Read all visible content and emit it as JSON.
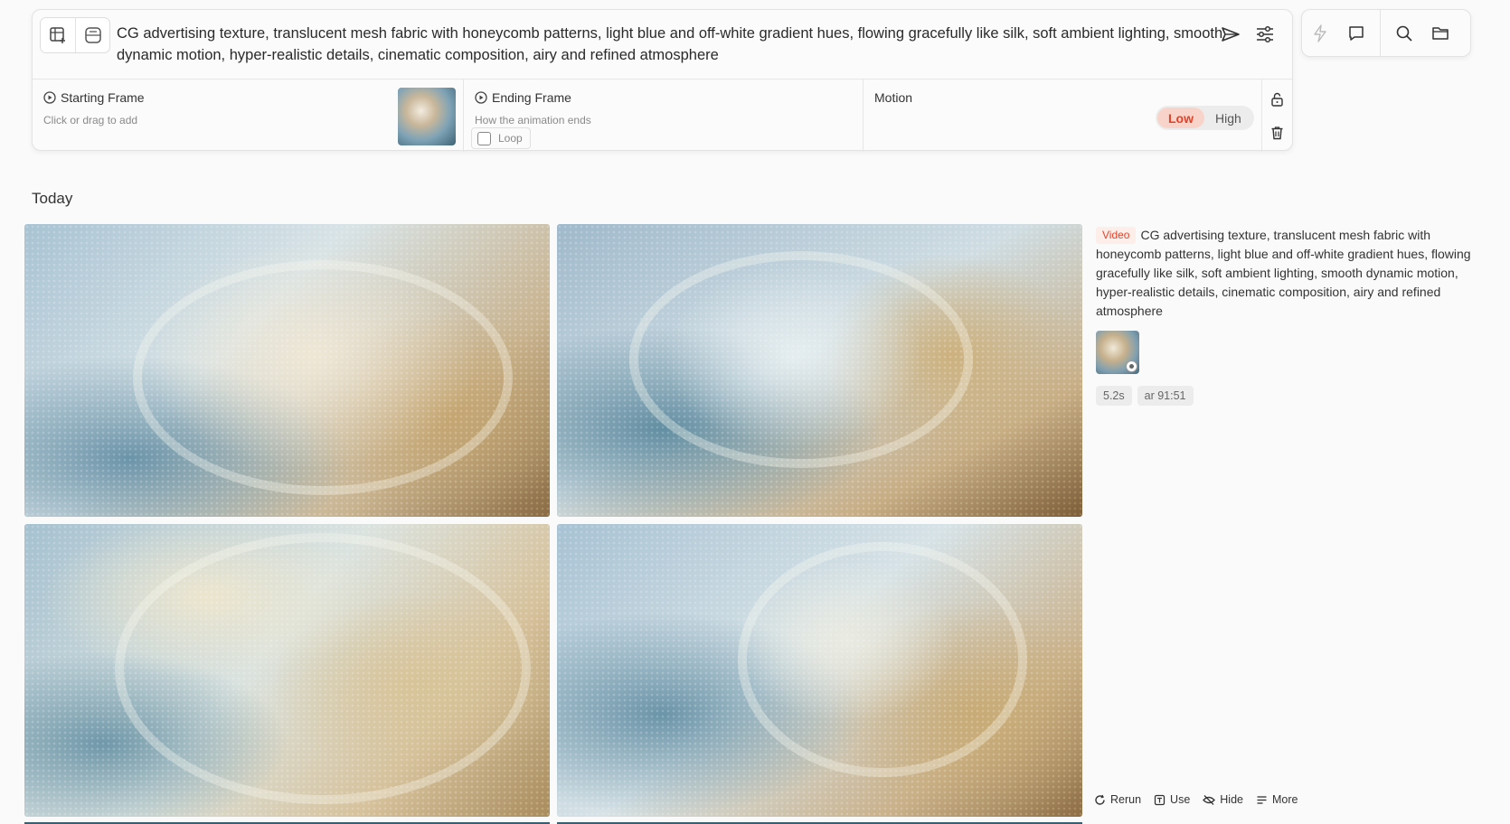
{
  "composer": {
    "prompt": "CG advertising texture, translucent mesh fabric with honeycomb patterns, light blue and off-white gradient hues, flowing gracefully like silk, soft ambient lighting, smooth dynamic motion, hyper-realistic details, cinematic composition, airy and refined atmosphere",
    "starting_frame": {
      "label": "Starting Frame",
      "hint": "Click or drag to add"
    },
    "ending_frame": {
      "label": "Ending Frame",
      "hint": "How the animation ends",
      "loop_label": "Loop",
      "loop_checked": false
    },
    "motion": {
      "label": "Motion",
      "options": [
        "Low",
        "High"
      ],
      "selected": "Low"
    }
  },
  "section": {
    "title": "Today"
  },
  "result": {
    "badge": "Video",
    "prompt": "CG advertising texture, translucent mesh fabric with honeycomb patterns, light blue and off-white gradient hues, flowing gracefully like silk, soft ambient lighting, smooth dynamic motion, hyper-realistic details, cinematic composition, airy and refined atmosphere",
    "chips": [
      "5.2s",
      "ar 91:51"
    ],
    "actions": [
      "Rerun",
      "Use",
      "Hide",
      "More"
    ]
  },
  "colors": {
    "accent": "#e0432a",
    "accent_bg": "#f8d3c9"
  }
}
